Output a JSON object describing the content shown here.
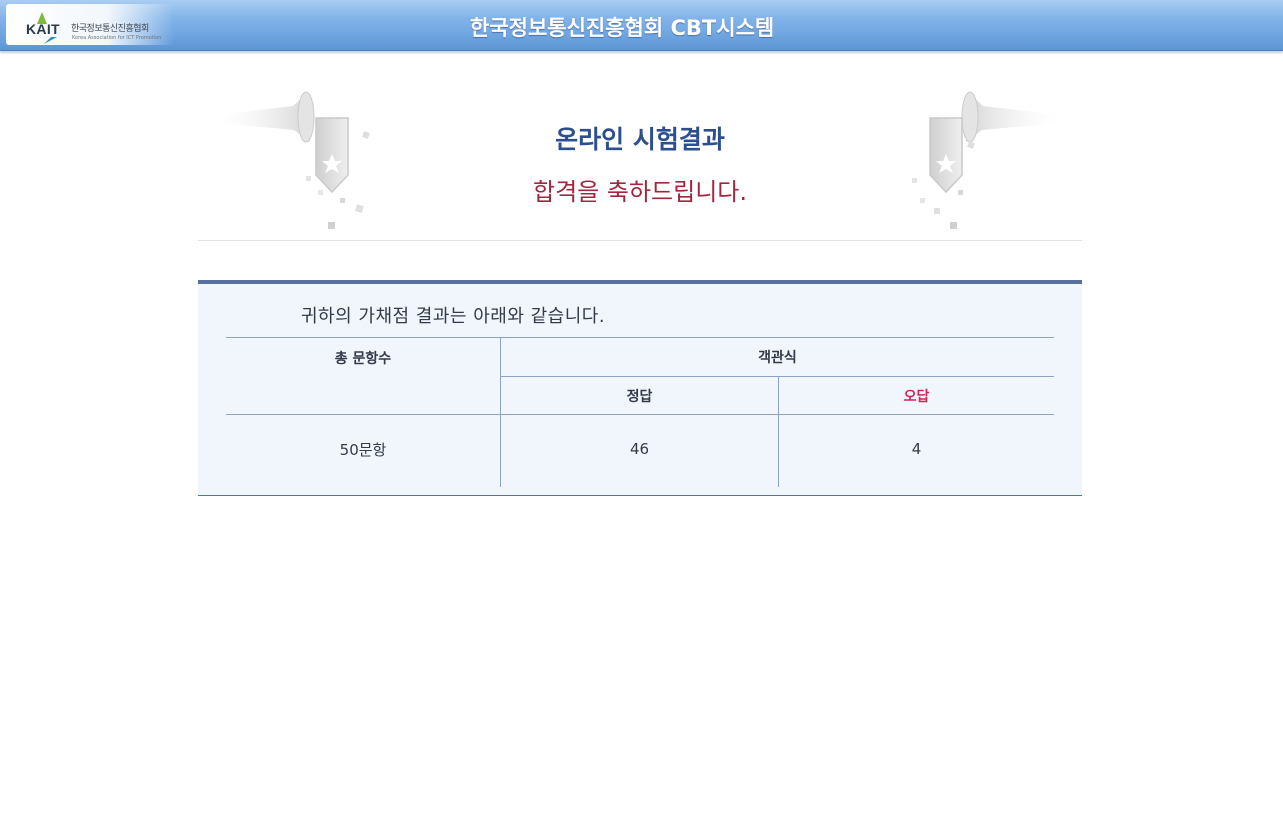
{
  "header": {
    "logo_text": "KAIT",
    "logo_org_kor": "한국정보통신진흥협회",
    "logo_org_eng": "Korea Association for ICT Promotion",
    "title": "한국정보통신진흥협회 CBT시스템",
    "colors": {
      "bar": "#6fa5e0",
      "title": "#ffffff"
    }
  },
  "banner": {
    "title": "온라인 시험결과",
    "message": "합격을 축하드립니다.",
    "decoration_icon": "trumpet-banner-star-icon",
    "colors": {
      "title": "#2e4f8f",
      "message": "#a3263f"
    }
  },
  "result": {
    "intro": "귀하의 가채점 결과는 아래와 같습니다.",
    "table": {
      "total_header": "총 문항수",
      "objective_header": "객관식",
      "correct_header": "정답",
      "wrong_header": "오답",
      "total_value": "50문항",
      "correct_value": "46",
      "wrong_value": "4"
    },
    "colors": {
      "wrong_header": "#d42457",
      "panel": "#f1f6fd",
      "border": "#56709f"
    }
  }
}
